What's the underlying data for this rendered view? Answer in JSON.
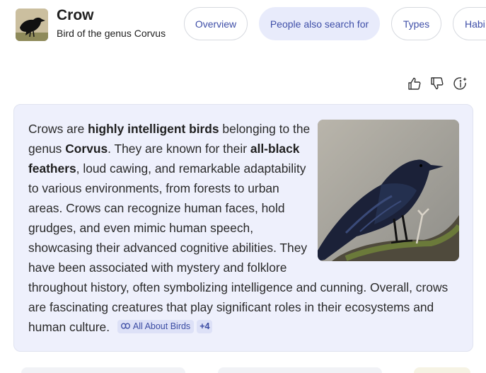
{
  "entity": {
    "title": "Crow",
    "subtitle": "Bird of the genus Corvus"
  },
  "tabs": [
    {
      "label": "Overview",
      "active": false
    },
    {
      "label": "People also search for",
      "active": true
    },
    {
      "label": "Types",
      "active": false
    },
    {
      "label": "Habi",
      "active": false
    }
  ],
  "feedback_icons": [
    "thumbs-up-icon",
    "thumbs-down-icon",
    "info-sparkle-icon"
  ],
  "description": {
    "p1": "Crows are ",
    "b1": "highly intelligent birds",
    "p2": " belonging to the genus ",
    "b2": "Corvus",
    "p3": ". They are known for their ",
    "b3": "all-black feathers",
    "p4": ", loud cawing, and remarkable adaptability to various environments, from forests to urban areas. Crows can recognize human faces, hold grudges, and even mimic human speech, showcasing their advanced cognitive abilities. They have been associated with mystery and folklore throughout history, often symbolizing intelligence and cunning. Overall, crows are fascinating creatures that play significant roles in their ecosystems and human culture."
  },
  "source": {
    "label": "All About Birds",
    "more": "+4",
    "icon": "link-icon"
  },
  "colors": {
    "accent": "#3f4fa8",
    "card_bg": "#eef0fc",
    "active_chip_bg": "#e8ebfb"
  }
}
